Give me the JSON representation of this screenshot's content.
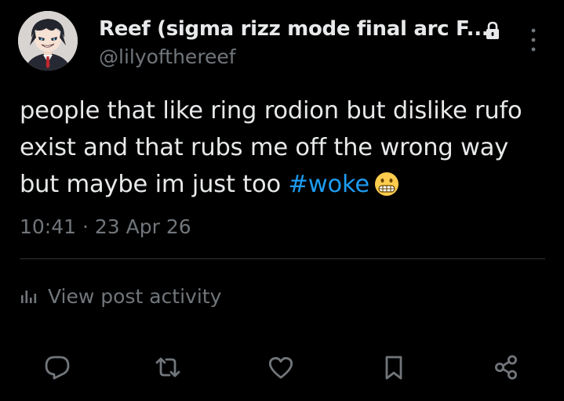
{
  "author": {
    "display_name": "Reef (sigma rizz mode final arc F...",
    "handle": "@lilyofthereef",
    "protected": true
  },
  "post": {
    "text_before_hashtag": "people that like ring rodion but dislike rufo exist and that rubs me off the wrong way but maybe im just too ",
    "hashtag": "#woke",
    "emoji": "grimacing-face",
    "timestamp": "10:41 · 23 Apr 26"
  },
  "activity": {
    "label": "View post activity",
    "icon": "analytics-icon"
  },
  "actions": [
    {
      "name": "reply-button",
      "icon": "speech-bubble-icon"
    },
    {
      "name": "repost-button",
      "icon": "repost-arrows-icon"
    },
    {
      "name": "like-button",
      "icon": "heart-icon"
    },
    {
      "name": "bookmark-button",
      "icon": "bookmark-icon"
    },
    {
      "name": "share-button",
      "icon": "share-nodes-icon"
    }
  ],
  "colors": {
    "background": "#000000",
    "text_primary": "#e7e9ea",
    "text_secondary": "#71767b",
    "accent": "#1d9bf0",
    "divider": "#2f3336"
  }
}
